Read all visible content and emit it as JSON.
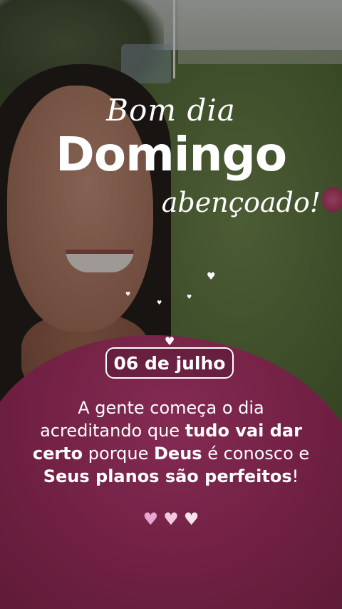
{
  "greeting": {
    "line1": "Bom dia",
    "line2": "Domingo",
    "line3": "abençoado!"
  },
  "date": "06 de julho",
  "message": {
    "p1": "A gente começa o dia acreditando que ",
    "b1": "tudo vai dar certo",
    "p2": " porque ",
    "b2": "Deus",
    "p3": " é conosco e ",
    "b3": "Seus planos são perfeitos",
    "p4": "!"
  },
  "hearts": {
    "icon": "heart-icon",
    "colors": [
      "#e7a6cf",
      "#f3c8dc",
      "#f9e3ea"
    ]
  },
  "colors": {
    "text": "#ffffff",
    "sweater": "#b02a66"
  }
}
